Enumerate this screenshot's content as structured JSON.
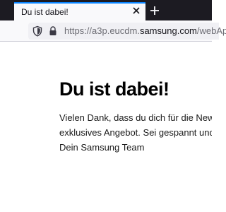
{
  "browser": {
    "tab": {
      "title": "Du ist dabei!",
      "close_icon": "close-icon"
    },
    "new_tab_icon": "plus-icon",
    "url": {
      "prefix": "https://a3p.eucdm.",
      "domain": "samsung.com",
      "path": "/webApp/"
    },
    "icons": {
      "tracking": "shield-icon",
      "security": "lock-icon"
    },
    "colors": {
      "tabstrip": "#1c1b22",
      "active_tab": "#f9f9fb",
      "accent": "#0a84ff"
    }
  },
  "page": {
    "headline": "Du ist dabei!",
    "body_lines": [
      "Vielen Dank, dass du dich für die New",
      "exklusives Angebot. Sei gespannt und",
      "Dein Samsung Team"
    ]
  }
}
